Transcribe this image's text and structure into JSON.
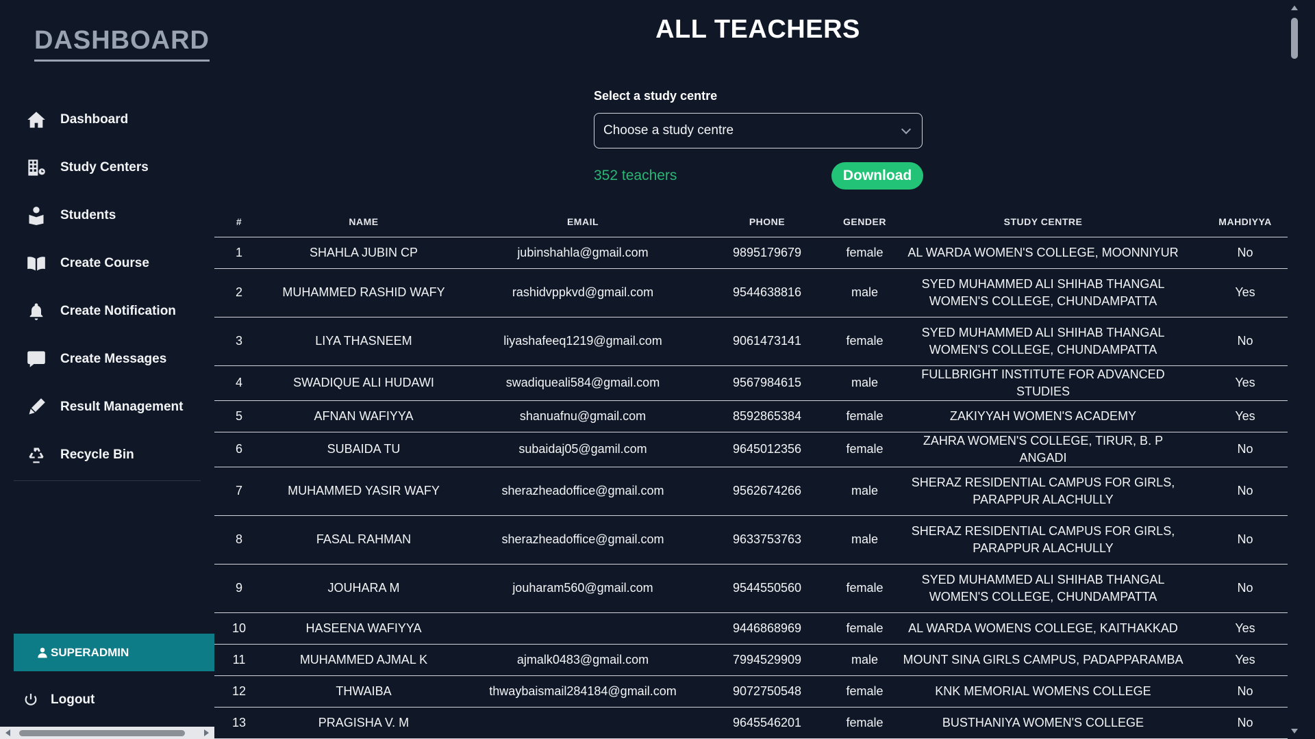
{
  "sidebar": {
    "brand": "DASHBOARD",
    "items": [
      {
        "label": "Dashboard",
        "icon": "home-icon"
      },
      {
        "label": "Study Centers",
        "icon": "building-icon"
      },
      {
        "label": "Students",
        "icon": "student-icon"
      },
      {
        "label": "Create Course",
        "icon": "book-open-icon"
      },
      {
        "label": "Create Notification",
        "icon": "bell-icon"
      },
      {
        "label": "Create Messages",
        "icon": "message-icon"
      },
      {
        "label": "Result Management",
        "icon": "pen-icon"
      },
      {
        "label": "Recycle Bin",
        "icon": "recycle-icon"
      }
    ],
    "role": "SUPERADMIN",
    "logout": "Logout"
  },
  "main": {
    "title": "ALL TEACHERS",
    "select_label": "Select a study centre",
    "select_value": "Choose a study centre",
    "count": "352 teachers",
    "download_label": "Download"
  },
  "table": {
    "headers": [
      "#",
      "NAME",
      "EMAIL",
      "PHONE",
      "GENDER",
      "STUDY CENTRE",
      "MAHDIYYA"
    ],
    "rows": [
      {
        "n": "1",
        "name": "SHAHLA JUBIN CP",
        "email": "jubinshahla@gmail.com",
        "phone": "9895179679",
        "gender": "female",
        "centre": "AL WARDA WOMEN'S COLLEGE, MOONNIYUR",
        "mahdiyya": "No"
      },
      {
        "n": "2",
        "name": "MUHAMMED RASHID WAFY",
        "email": "rashidvppkvd@gmail.com",
        "phone": "9544638816",
        "gender": "male",
        "centre": "SYED MUHAMMED ALI SHIHAB THANGAL WOMEN'S COLLEGE, CHUNDAMPATTA",
        "mahdiyya": "Yes"
      },
      {
        "n": "3",
        "name": "LIYA THASNEEM",
        "email": "liyashafeeq1219@gmail.com",
        "phone": "9061473141",
        "gender": "female",
        "centre": "SYED MUHAMMED ALI SHIHAB THANGAL WOMEN'S COLLEGE, CHUNDAMPATTA",
        "mahdiyya": "No"
      },
      {
        "n": "4",
        "name": "SWADIQUE ALI HUDAWI",
        "email": "swadiqueali584@gmail.com",
        "phone": "9567984615",
        "gender": "male",
        "centre": "FULLBRIGHT INSTITUTE FOR ADVANCED STUDIES",
        "mahdiyya": "Yes"
      },
      {
        "n": "5",
        "name": "AFNAN WAFIYYA",
        "email": "shanuafnu@gmail.com",
        "phone": "8592865384",
        "gender": "female",
        "centre": "ZAKIYYAH WOMEN'S ACADEMY",
        "mahdiyya": "Yes"
      },
      {
        "n": "6",
        "name": "SUBAIDA TU",
        "email": "subaidaj05@gamil.com",
        "phone": "9645012356",
        "gender": "female",
        "centre": "ZAHRA WOMEN'S COLLEGE, TIRUR, B. P ANGADI",
        "mahdiyya": "No"
      },
      {
        "n": "7",
        "name": "MUHAMMED YASIR WAFY",
        "email": "sherazheadoffice@gmail.com",
        "phone": "9562674266",
        "gender": "male",
        "centre": "SHERAZ RESIDENTIAL CAMPUS FOR GIRLS, PARAPPUR ALACHULLY",
        "mahdiyya": "No"
      },
      {
        "n": "8",
        "name": "FASAL RAHMAN",
        "email": "sherazheadoffice@gmail.com",
        "phone": "9633753763",
        "gender": "male",
        "centre": "SHERAZ RESIDENTIAL CAMPUS FOR GIRLS, PARAPPUR ALACHULLY",
        "mahdiyya": "No"
      },
      {
        "n": "9",
        "name": "JOUHARA M",
        "email": "jouharam560@gmail.com",
        "phone": "9544550560",
        "gender": "female",
        "centre": "SYED MUHAMMED ALI SHIHAB THANGAL WOMEN'S COLLEGE, CHUNDAMPATTA",
        "mahdiyya": "No"
      },
      {
        "n": "10",
        "name": "HASEENA WAFIYYA",
        "email": "",
        "phone": "9446868969",
        "gender": "female",
        "centre": "AL WARDA WOMENS COLLEGE, KAITHAKKAD",
        "mahdiyya": "Yes"
      },
      {
        "n": "11",
        "name": "MUHAMMED AJMAL K",
        "email": "ajmalk0483@gmail.com",
        "phone": "7994529909",
        "gender": "male",
        "centre": "MOUNT SINA GIRLS CAMPUS, PADAPPARAMBA",
        "mahdiyya": "Yes"
      },
      {
        "n": "12",
        "name": "THWAIBA",
        "email": "thwaybaismail284184@gmail.com",
        "phone": "9072750548",
        "gender": "female",
        "centre": "KNK MEMORIAL WOMENS COLLEGE",
        "mahdiyya": "No"
      },
      {
        "n": "13",
        "name": "PRAGISHA V. M",
        "email": "",
        "phone": "9645546201",
        "gender": "female",
        "centre": "BUSTHANIYA WOMEN'S COLLEGE",
        "mahdiyya": "No"
      }
    ]
  }
}
